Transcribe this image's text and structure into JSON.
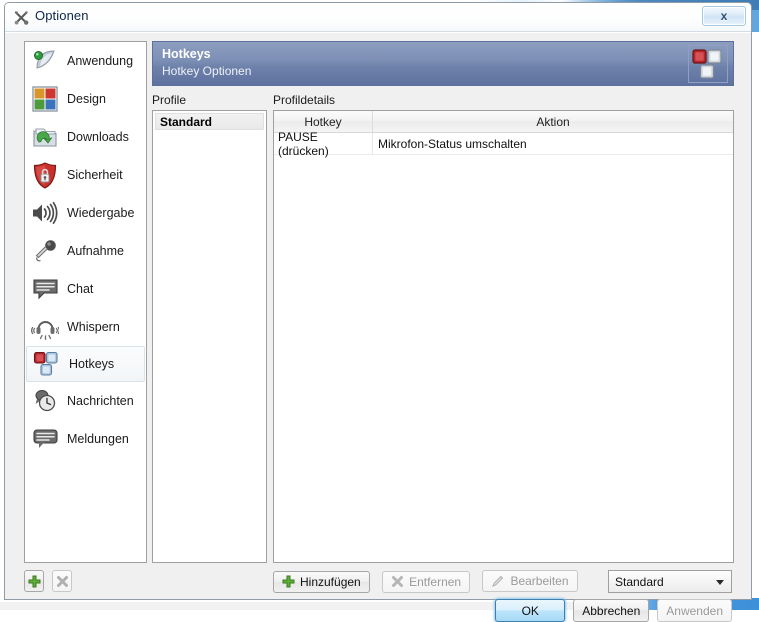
{
  "window": {
    "title": "Optionen",
    "title_icon": "tools-icon",
    "close_label": "x"
  },
  "sidebar": {
    "items": [
      {
        "label": "Anwendung",
        "icon": "application-icon",
        "selected": false
      },
      {
        "label": "Design",
        "icon": "design-icon",
        "selected": false
      },
      {
        "label": "Downloads",
        "icon": "downloads-icon",
        "selected": false
      },
      {
        "label": "Sicherheit",
        "icon": "security-shield-icon",
        "selected": false
      },
      {
        "label": "Wiedergabe",
        "icon": "playback-speaker-icon",
        "selected": false
      },
      {
        "label": "Aufnahme",
        "icon": "microphone-icon",
        "selected": false
      },
      {
        "label": "Chat",
        "icon": "chat-bubble-icon",
        "selected": false
      },
      {
        "label": "Whispern",
        "icon": "headset-whisper-icon",
        "selected": false
      },
      {
        "label": "Hotkeys",
        "icon": "hotkeys-icon",
        "selected": true
      },
      {
        "label": "Nachrichten",
        "icon": "messages-clock-icon",
        "selected": false
      },
      {
        "label": "Meldungen",
        "icon": "notifications-bubble-icon",
        "selected": false
      }
    ]
  },
  "banner": {
    "title": "Hotkeys",
    "subtitle": "Hotkey Optionen",
    "icon": "hotkeys-icon"
  },
  "profiles": {
    "label": "Profile",
    "items": [
      {
        "name": "Standard",
        "selected": true
      }
    ],
    "add_button_icon": "plus-icon",
    "remove_button_icon": "remove-x-icon"
  },
  "details": {
    "label": "Profildetails",
    "columns": [
      "Hotkey",
      "Aktion"
    ],
    "rows": [
      {
        "hotkey": "PAUSE (drücken)",
        "aktion": "Mikrofon-Status umschalten"
      }
    ]
  },
  "toolbar": {
    "add_label": "Hinzufügen",
    "add_icon": "plus-icon",
    "remove_label": "Entfernen",
    "remove_icon": "remove-x-icon",
    "edit_label": "Bearbeiten",
    "edit_icon": "pencil-icon",
    "profile_select_value": "Standard"
  },
  "dialog_buttons": {
    "ok": "OK",
    "cancel": "Abbrechen",
    "apply": "Anwenden"
  },
  "colors": {
    "banner_top": "#8c9dc0",
    "banner_bottom": "#5f72a0",
    "accent_blue": "#3c7fb1",
    "window_bg": "#f0f0f0",
    "hotkey_red": "#b4262b",
    "plus_green": "#5fae38"
  }
}
